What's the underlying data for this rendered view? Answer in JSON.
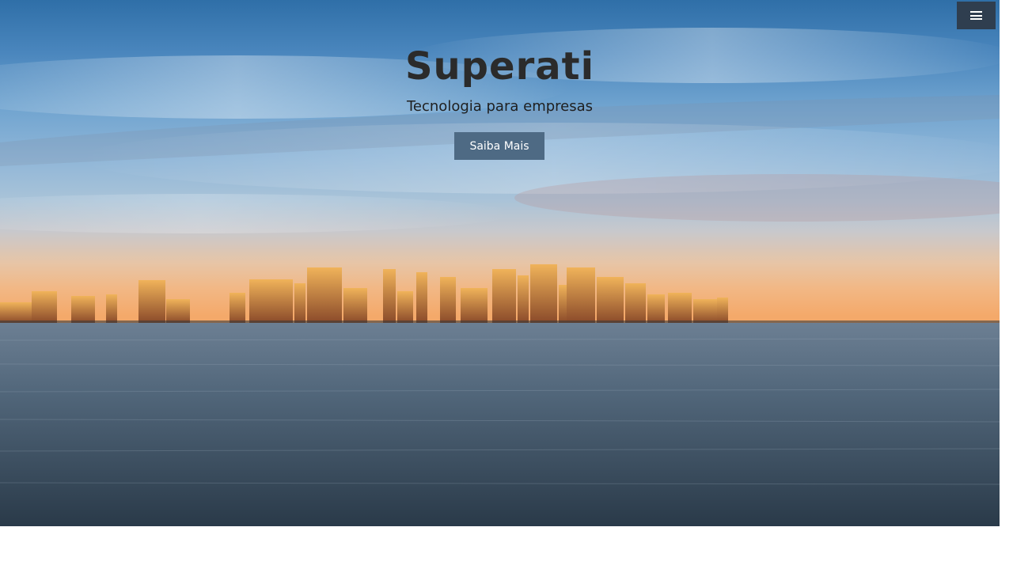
{
  "header": {
    "menu_icon": "hamburger-menu-icon"
  },
  "hero": {
    "title": "Superati",
    "tagline": "Tecnologia para empresas",
    "cta_label": "Saiba Mais",
    "background_image": "city-skyline-sunset-water"
  },
  "colors": {
    "menu_button_bg": "#2f3e4f",
    "cta_bg": "#4e6a84",
    "title_color": "#2b2b2b",
    "page_bg": "#ffffff"
  }
}
